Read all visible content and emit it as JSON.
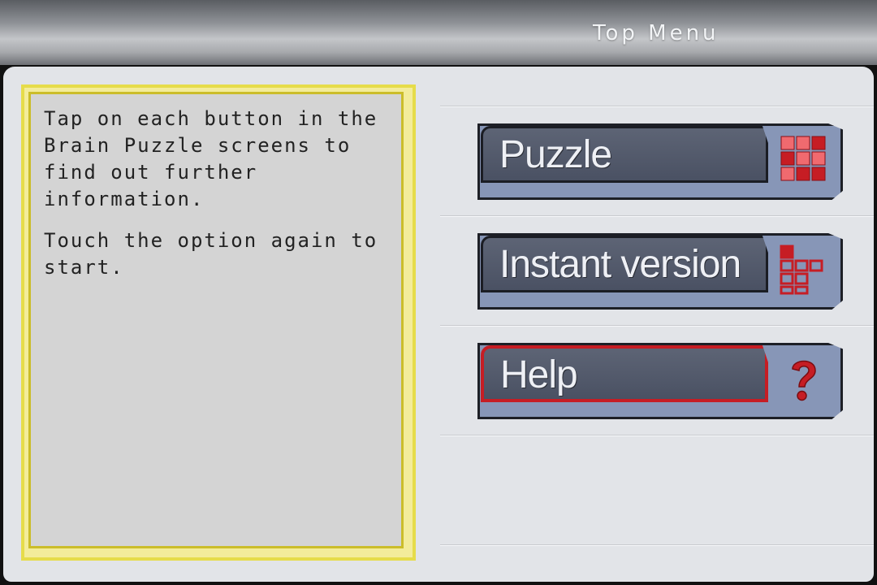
{
  "header": {
    "title": "Top Menu"
  },
  "info": {
    "paragraphs": [
      "Tap on each button in the Brain Puzzle screens to find out further information.",
      "Touch the option again to start."
    ]
  },
  "menu": {
    "items": [
      {
        "label": "Puzzle",
        "icon": "grid-icon",
        "selected": false
      },
      {
        "label": "Instant version",
        "icon": "blocks-icon",
        "selected": false
      },
      {
        "label": "Help",
        "icon": "question-mark-icon",
        "selected": true
      }
    ]
  },
  "colors": {
    "accent_red": "#c61d24",
    "button_blue": "#8796b7",
    "label_plate": "#4f5668",
    "info_border": "#e6dc4a"
  }
}
